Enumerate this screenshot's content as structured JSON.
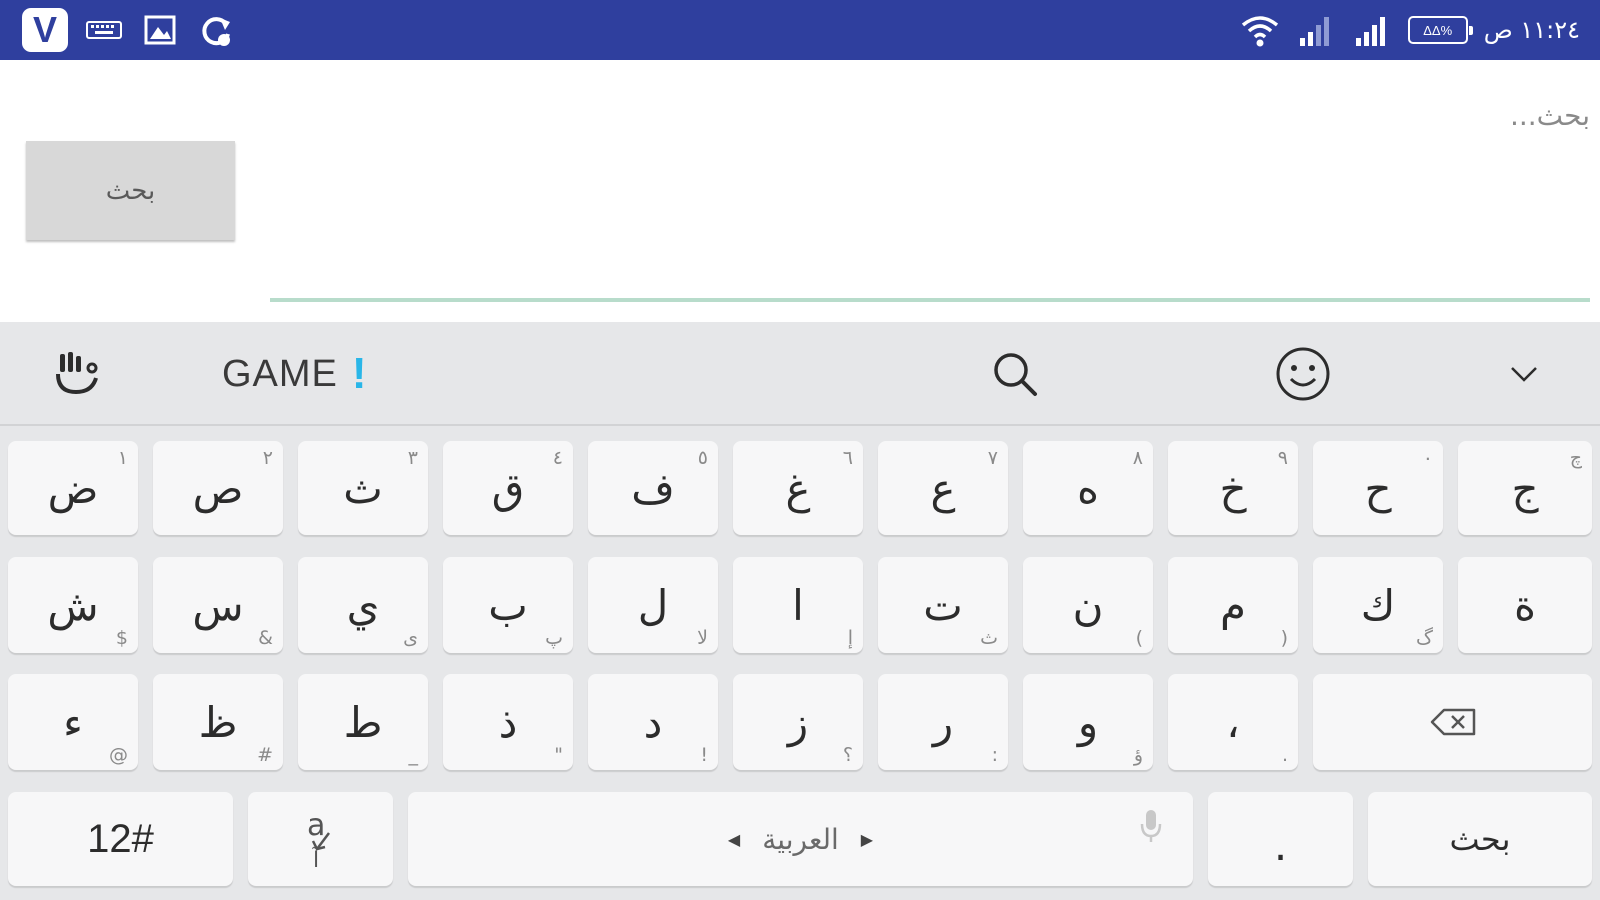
{
  "status_bar": {
    "app_icon": "vpn-v-logo",
    "left_icons": [
      "keyboard-icon",
      "image-icon",
      "sync-icon"
    ],
    "right_icons": [
      "wifi-icon",
      "signal-icon",
      "signal-icon"
    ],
    "battery_text": "ΔΔ%",
    "time": "۱۱:۲٤ ص"
  },
  "search": {
    "placeholder": "بحث...",
    "button_label": "بحث"
  },
  "keyboard": {
    "toolbar": {
      "game_label": "GAME",
      "game_mark": "!",
      "icons": [
        "touchpal-hand-icon",
        "search-icon",
        "emoji-icon",
        "chevron-down-icon"
      ]
    },
    "rows": [
      [
        {
          "main": "ض",
          "hint": "١"
        },
        {
          "main": "ص",
          "hint": "٢"
        },
        {
          "main": "ث",
          "hint": "٣"
        },
        {
          "main": "ق",
          "hint": "٤"
        },
        {
          "main": "ف",
          "hint": "٥"
        },
        {
          "main": "غ",
          "hint": "٦"
        },
        {
          "main": "ع",
          "hint": "٧"
        },
        {
          "main": "ه",
          "hint": "٨"
        },
        {
          "main": "خ",
          "hint": "٩"
        },
        {
          "main": "ح",
          "hint": "٠"
        },
        {
          "main": "ج",
          "hint": "چ"
        }
      ],
      [
        {
          "main": "ش",
          "hint": "$"
        },
        {
          "main": "س",
          "hint": "&"
        },
        {
          "main": "ي",
          "hint": "ى"
        },
        {
          "main": "ب",
          "hint": "پ"
        },
        {
          "main": "ل",
          "hint": "لا"
        },
        {
          "main": "ا",
          "hint": "إ"
        },
        {
          "main": "ت",
          "hint": "ث"
        },
        {
          "main": "ن",
          "hint": "("
        },
        {
          "main": "م",
          "hint": ")"
        },
        {
          "main": "ك",
          "hint": "گ"
        },
        {
          "main": "ة",
          "hint": ""
        }
      ],
      [
        {
          "main": "ء",
          "hint": "@"
        },
        {
          "main": "ظ",
          "hint": "#"
        },
        {
          "main": "ط",
          "hint": "_"
        },
        {
          "main": "ذ",
          "hint": "\""
        },
        {
          "main": "د",
          "hint": "!"
        },
        {
          "main": "ز",
          "hint": "؟"
        },
        {
          "main": "ر",
          "hint": ":"
        },
        {
          "main": "و",
          "hint": "ؤ"
        },
        {
          "main": "،",
          "hint": "."
        }
      ]
    ],
    "backspace_icon": "backspace-icon",
    "bottom": {
      "symbols_label": "12#",
      "lang_switch_glyph": "a↓آ",
      "space_lang": "العربية",
      "mic_icon": "mic-icon",
      "period_label": ".",
      "enter_label": "بحث"
    }
  }
}
